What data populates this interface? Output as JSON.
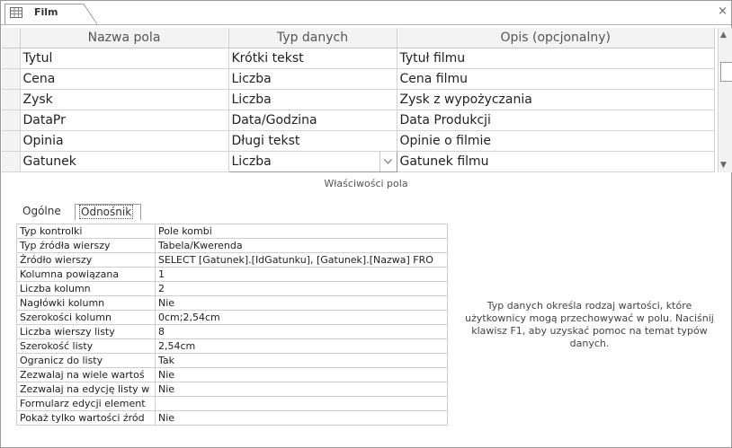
{
  "document": {
    "tab_label": "Film",
    "tab_icon": "table-icon",
    "close_label": "×"
  },
  "grid": {
    "headers": [
      "Nazwa pola",
      "Typ danych",
      "Opis (opcjonalny)"
    ],
    "rows": [
      {
        "name": "Tytul",
        "type": "Krótki tekst",
        "desc": "Tytuł filmu"
      },
      {
        "name": "Cena",
        "type": "Liczba",
        "desc": "Cena filmu"
      },
      {
        "name": "Zysk",
        "type": "Liczba",
        "desc": "Zysk z wypożyczania"
      },
      {
        "name": "DataPr",
        "type": "Data/Godzina",
        "desc": "Data Produkcji"
      },
      {
        "name": "Opinia",
        "type": "Długi tekst",
        "desc": "Opinie o filmie"
      },
      {
        "name": "Gatunek",
        "type": "Liczba",
        "desc": "Gatunek filmu"
      }
    ]
  },
  "field_properties": {
    "title": "Właściwości pola",
    "tabs": {
      "general": "Ogólne",
      "lookup": "Odnośnik"
    },
    "active_tab": "lookup",
    "rows": [
      {
        "key": "Typ kontrolki",
        "value": "Pole kombi"
      },
      {
        "key": "Typ źródła wierszy",
        "value": "Tabela/Kwerenda"
      },
      {
        "key": "Źródło wierszy",
        "value": "SELECT [Gatunek].[IdGatunku], [Gatunek].[Nazwa] FRO"
      },
      {
        "key": "Kolumna powiązana",
        "value": "1"
      },
      {
        "key": "Liczba kolumn",
        "value": "2"
      },
      {
        "key": "Nagłówki kolumn",
        "value": "Nie"
      },
      {
        "key": "Szerokości kolumn",
        "value": "0cm;2,54cm"
      },
      {
        "key": "Liczba wierszy listy",
        "value": "8"
      },
      {
        "key": "Szerokość listy",
        "value": "2,54cm"
      },
      {
        "key": "Ogranicz do listy",
        "value": "Tak"
      },
      {
        "key": "Zezwalaj na wiele wartoś",
        "value": "Nie"
      },
      {
        "key": "Zezwalaj na edycję listy w",
        "value": "Nie"
      },
      {
        "key": "Formularz edycji element",
        "value": ""
      },
      {
        "key": "Pokaż tylko wartości źród",
        "value": "Nie"
      }
    ],
    "help_text": "Typ danych określa rodzaj wartości, które użytkownicy mogą przechowywać w polu. Naciśnij klawisz F1, aby uzyskać pomoc na temat typów danych."
  },
  "colors": {
    "border": "#9a9a9a",
    "header_bg": "#f3f3f3"
  }
}
